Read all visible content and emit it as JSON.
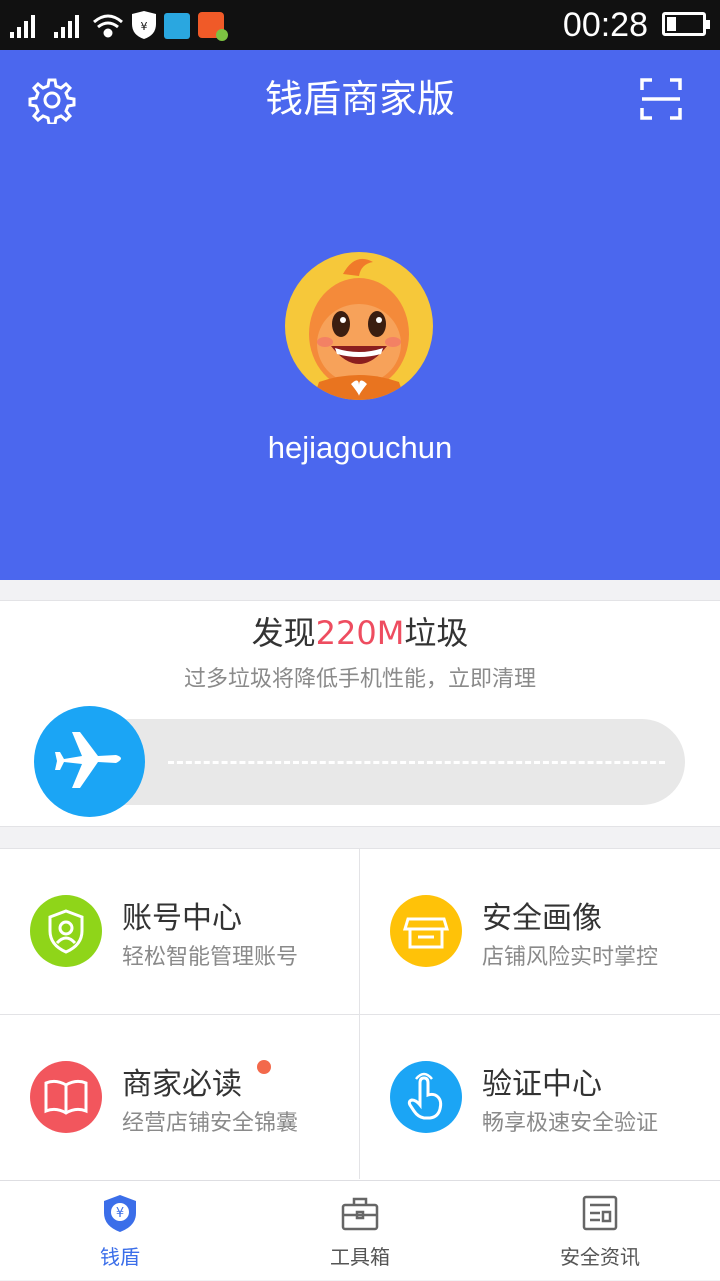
{
  "status_bar": {
    "time": "00:28"
  },
  "header": {
    "title": "钱盾商家版",
    "username": "hejiagouchun"
  },
  "clean": {
    "title_prefix": "发现",
    "title_highlight": "220M",
    "title_suffix": "垃圾",
    "subtitle": "过多垃圾将降低手机性能，立即清理"
  },
  "grid": [
    {
      "title": "账号中心",
      "subtitle": "轻松智能管理账号",
      "icon": "account-shield-icon",
      "color": "#8fd519"
    },
    {
      "title": "安全画像",
      "subtitle": "店铺风险实时掌控",
      "icon": "store-icon",
      "color": "#ffc208"
    },
    {
      "title": "商家必读",
      "subtitle": "经营店铺安全锦囊",
      "icon": "book-icon",
      "color": "#f2565d"
    },
    {
      "title": "验证中心",
      "subtitle": "畅享极速安全验证",
      "icon": "touch-hand-icon",
      "color": "#1ba5f5"
    }
  ],
  "tabs": [
    {
      "label": "钱盾",
      "icon": "shield-yen-icon",
      "active": true
    },
    {
      "label": "工具箱",
      "icon": "toolbox-icon",
      "active": false
    },
    {
      "label": "安全资讯",
      "icon": "news-icon",
      "active": false
    }
  ],
  "colors": {
    "header_bg": "#4b67ee",
    "highlight": "#ee4d60",
    "active_tab": "#3b6ee9"
  }
}
